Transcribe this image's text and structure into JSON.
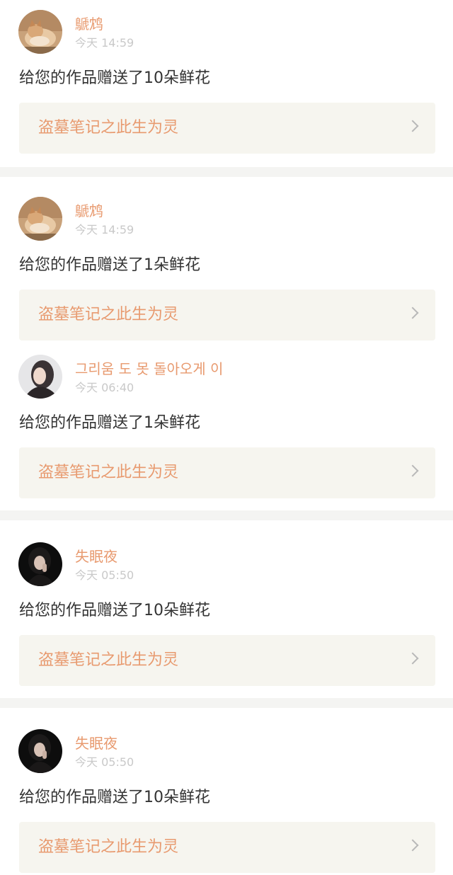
{
  "notifications": [
    {
      "username": "鷈鸩",
      "time": "今天 14:59",
      "message": "给您的作品赠送了10朵鲜花",
      "work_title": "盗墓笔记之此生为灵",
      "avatar": "cat-avatar"
    },
    {
      "username": "鷈鸩",
      "time": "今天 14:59",
      "message": "给您的作品赠送了1朵鲜花",
      "work_title": "盗墓笔记之此生为灵",
      "avatar": "cat-avatar"
    },
    {
      "username": "그리움 도 못 돌아오게 이",
      "time": "今天 06:40",
      "message": "给您的作品赠送了1朵鲜花",
      "work_title": "盗墓笔记之此生为灵",
      "avatar": "girl-avatar"
    },
    {
      "username": "失眠夜",
      "time": "今天 05:50",
      "message": "给您的作品赠送了10朵鲜花",
      "work_title": "盗墓笔记之此生为灵",
      "avatar": "dark-portrait-avatar"
    },
    {
      "username": "失眠夜",
      "time": "今天 05:50",
      "message": "给您的作品赠送了10朵鲜花",
      "work_title": "盗墓笔记之此生为灵",
      "avatar": "dark-portrait-avatar"
    }
  ],
  "colors": {
    "accent": "#e89a6f",
    "time_text": "#c9c9c9",
    "body_text": "#333333",
    "work_bg": "#f6f5ef",
    "separator": "#f4f4f2"
  }
}
